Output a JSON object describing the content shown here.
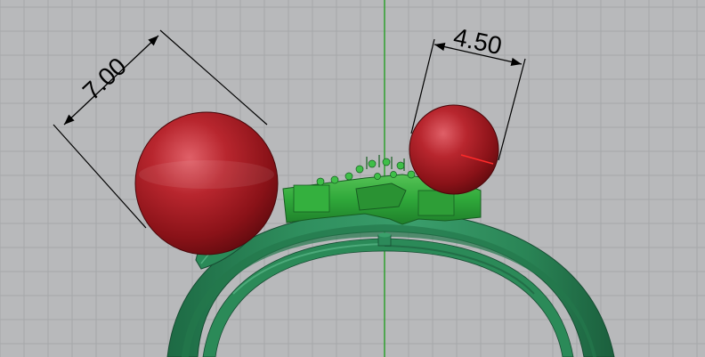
{
  "viewport": {
    "name": "perspective-3d-viewport",
    "background_color": "#b8b9bb",
    "grid_color": "#a6a7aa",
    "y_axis_color": "#2ea02e"
  },
  "model": {
    "ring_color": "#2c8a5a",
    "head_color": "#2fa83a",
    "sphere_color": "#b3232b"
  },
  "dimensions": [
    {
      "label": "7.00"
    },
    {
      "label": "4.50"
    }
  ]
}
